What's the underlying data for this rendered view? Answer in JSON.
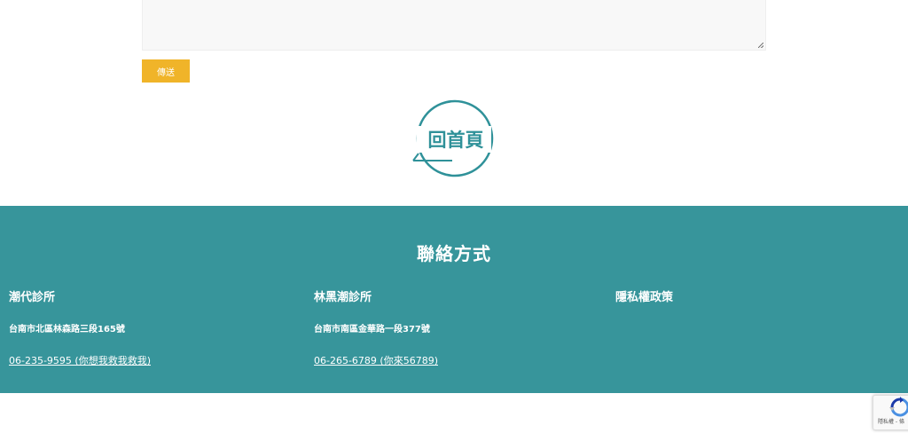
{
  "form": {
    "submit_label": "傳送"
  },
  "home_link": {
    "label": "回首頁"
  },
  "footer": {
    "title": "聯絡方式",
    "columns": [
      {
        "name": "潮代診所",
        "address": "台南市北區林森路三段165號",
        "phone": "06-235-9595 (你想我救我救我)"
      },
      {
        "name": "林黑潮診所",
        "address": "台南市南區金華路一段377號",
        "phone": "06-265-6789 (你來56789)"
      },
      {
        "name": "隱私權政策"
      }
    ]
  },
  "recaptcha": {
    "text": "隱私權 - 條"
  },
  "colors": {
    "footer_bg": "#37959b",
    "button_bg": "#f0b429",
    "icon_teal": "#2f9199"
  }
}
